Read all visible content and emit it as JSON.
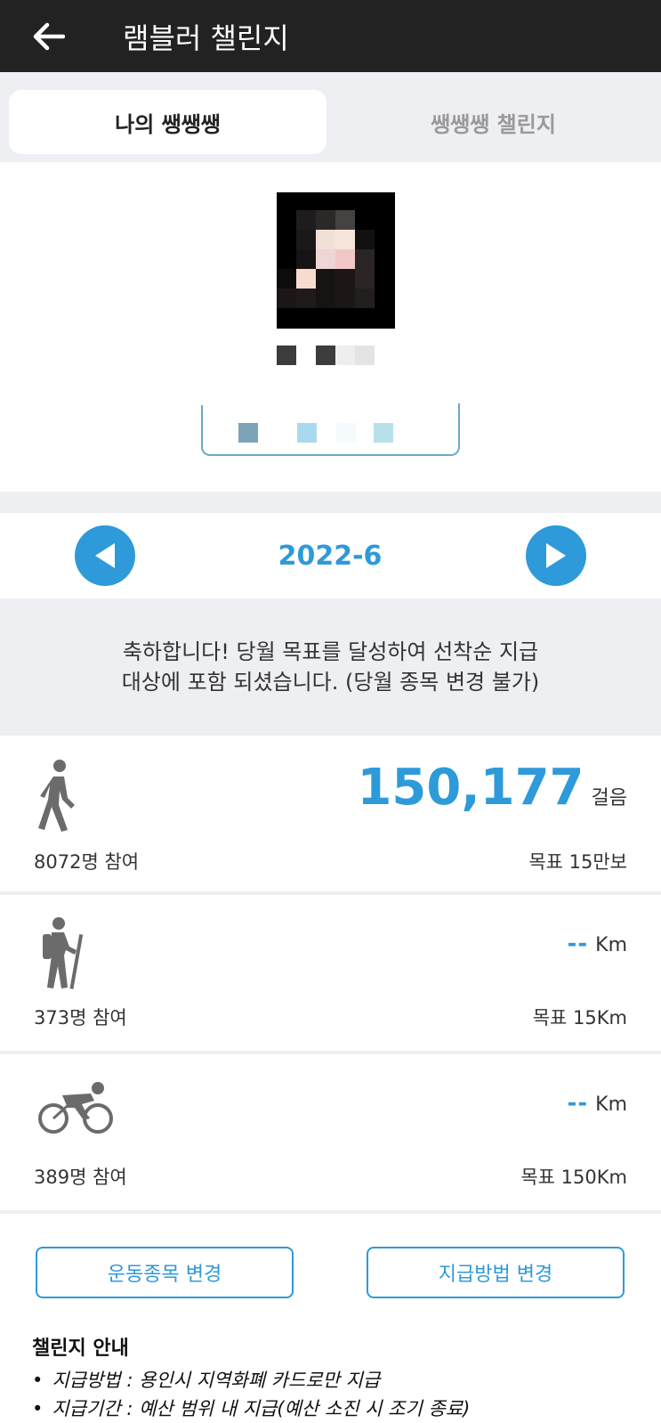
{
  "appbar": {
    "title": "램블러 챌린지",
    "back_icon": "arrow-left-icon"
  },
  "tabs": [
    {
      "label": "나의 쌩쌩쌩",
      "active": true
    },
    {
      "label": "쌩쌩쌩 챌린지",
      "active": false
    }
  ],
  "month_nav": {
    "label": "2022-6",
    "prev_icon": "triangle-left-icon",
    "next_icon": "triangle-right-icon",
    "accent": "#2e9ad9"
  },
  "notice": {
    "line1": "축하합니다! 당월 목표를 달성하여 선착순 지급",
    "line2": "대상에 포함 되셨습니다. (당월 종목 변경 불가)"
  },
  "activities": [
    {
      "icon": "walking-icon",
      "value": "150,177",
      "unit": "걸음",
      "participants": "8072명 참여",
      "goal": "목표 15만보"
    },
    {
      "icon": "hiking-icon",
      "value": "--",
      "unit": "Km",
      "participants": "373명 참여",
      "goal": "목표 15Km"
    },
    {
      "icon": "cycling-icon",
      "value": "--",
      "unit": "Km",
      "participants": "389명 참여",
      "goal": "목표 150Km"
    }
  ],
  "buttons": {
    "change_sport": "운동종목 변경",
    "change_payment": "지급방법 변경"
  },
  "guide": {
    "title": "챌린지 안내",
    "items": [
      "지급방법 : 용인시 지역화폐 카드로만 지급",
      "지급기간 : 예산 범위 내 지급(예산 소진 시 조기 종료)"
    ]
  }
}
